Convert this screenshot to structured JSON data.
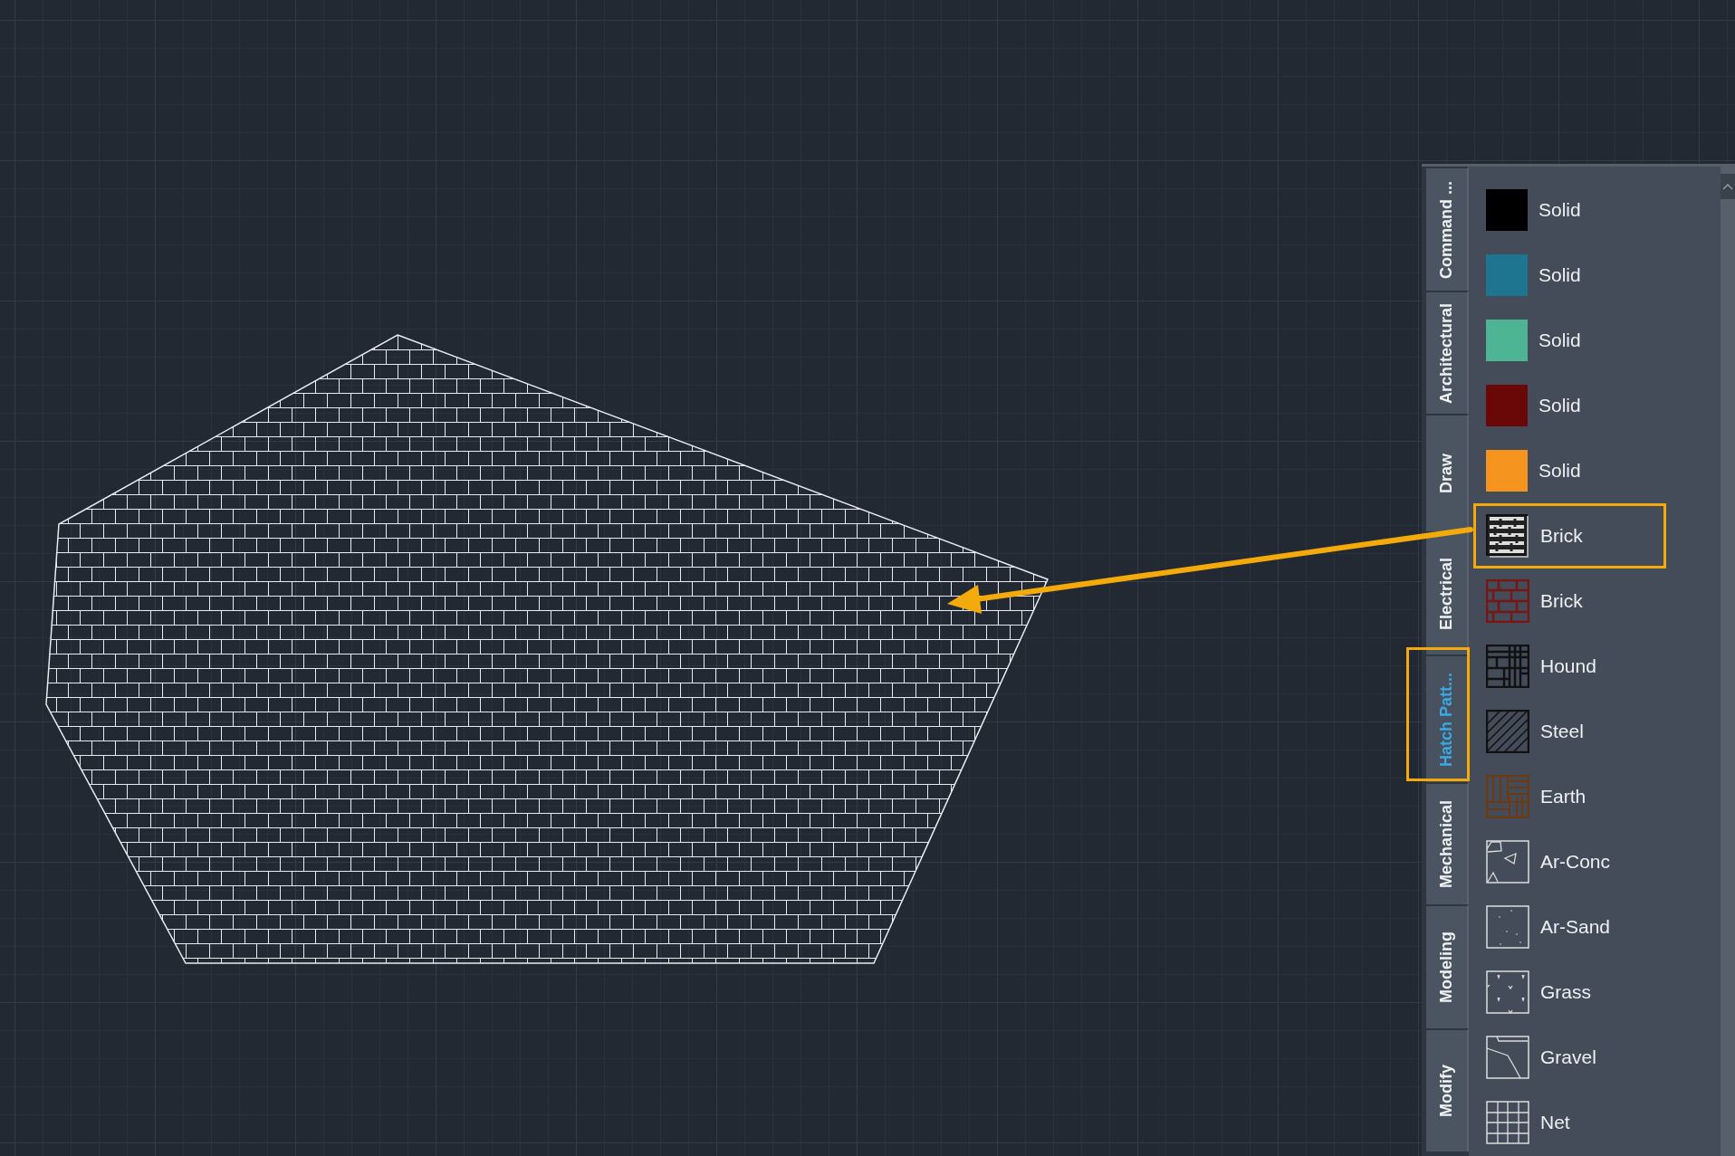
{
  "palette": {
    "tabs": [
      {
        "label": "Command ...",
        "selected": false,
        "highlighted": false
      },
      {
        "label": "Architectural",
        "selected": false,
        "highlighted": false
      },
      {
        "label": "Draw",
        "selected": false,
        "highlighted": false
      },
      {
        "label": "Electrical",
        "selected": false,
        "highlighted": false
      },
      {
        "label": "Hatch Patt...",
        "selected": true,
        "highlighted": true
      },
      {
        "label": "Mechanical",
        "selected": false,
        "highlighted": false
      },
      {
        "label": "Modeling",
        "selected": false,
        "highlighted": false
      },
      {
        "label": "Modify",
        "selected": false,
        "highlighted": false
      }
    ],
    "items": [
      {
        "label": "Solid",
        "kind": "solid",
        "color": "#000000",
        "highlighted": false
      },
      {
        "label": "Solid",
        "kind": "solid",
        "color": "#1e7590",
        "highlighted": false
      },
      {
        "label": "Solid",
        "kind": "solid",
        "color": "#4db593",
        "highlighted": false
      },
      {
        "label": "Solid",
        "kind": "solid",
        "color": "#6a0707",
        "highlighted": false
      },
      {
        "label": "Solid",
        "kind": "solid",
        "color": "#f5951f",
        "highlighted": false
      },
      {
        "label": "Brick",
        "kind": "brick",
        "highlighted": true
      },
      {
        "label": "Brick",
        "kind": "brick-red",
        "highlighted": false
      },
      {
        "label": "Hound",
        "kind": "hound",
        "highlighted": false
      },
      {
        "label": "Steel",
        "kind": "steel",
        "highlighted": false
      },
      {
        "label": "Earth",
        "kind": "earth",
        "highlighted": false
      },
      {
        "label": "Ar-Conc",
        "kind": "ar-conc",
        "highlighted": false
      },
      {
        "label": "Ar-Sand",
        "kind": "ar-sand",
        "highlighted": false
      },
      {
        "label": "Grass",
        "kind": "grass",
        "highlighted": false
      },
      {
        "label": "Gravel",
        "kind": "gravel",
        "highlighted": false
      },
      {
        "label": "Net",
        "kind": "net",
        "highlighted": false
      }
    ]
  }
}
